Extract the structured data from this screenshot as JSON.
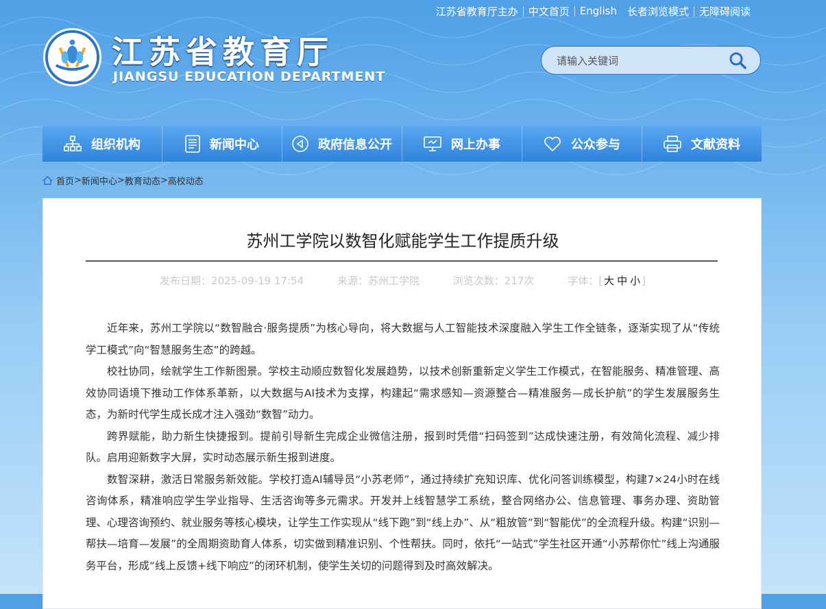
{
  "top_links": [
    "江苏省教育厅主办",
    "中文首页",
    "English",
    "长者浏览模式",
    "无障碍阅读"
  ],
  "site": {
    "title": "江苏省教育厅",
    "subtitle": "JIANGSU EDUCATION DEPARTMENT"
  },
  "search": {
    "placeholder": "请输入关键词"
  },
  "nav": [
    {
      "label": "组织机构",
      "icon": "org-chart-icon"
    },
    {
      "label": "新闻中心",
      "icon": "document-icon"
    },
    {
      "label": "政府信息公开",
      "icon": "megaphone-icon"
    },
    {
      "label": "网上办事",
      "icon": "monitor-icon"
    },
    {
      "label": "公众参与",
      "icon": "heart-icon"
    },
    {
      "label": "文献资料",
      "icon": "printer-icon"
    }
  ],
  "breadcrumb": [
    "首页",
    "新闻中心",
    "教育动态",
    "高校动态"
  ],
  "article": {
    "title": "苏州工学院以数智化赋能学生工作提质升级",
    "publish_date": "发布日期：2025-09-19 17:54",
    "source": "来源：苏州工学院",
    "views": "浏览次数：217次",
    "font_label": "字体：[",
    "font_large": "大",
    "font_medium": "中",
    "font_small": "小",
    "font_close": "]",
    "paragraphs": [
      "近年来，苏州工学院以“数智融合·服务提质”为核心导向，将大数据与人工智能技术深度融入学生工作全链条，逐渐实现了从“传统学工模式”向“智慧服务生态”的跨越。",
      "校社协同，绘就学生工作新图景。学校主动顺应数智化发展趋势，以技术创新重新定义学生工作模式，在智能服务、精准管理、高效协同语境下推动工作体系革新，以大数据与AI技术为支撑，构建起“需求感知—资源整合—精准服务—成长护航”的学生发展服务生态，为新时代学生成长成才注入强劲“数智”动力。",
      "跨界赋能，助力新生快捷报到。提前引导新生完成企业微信注册，报到时凭借“扫码签到”达成快速注册，有效简化流程、减少排队。启用迎新数字大屏，实时动态展示新生报到进度。",
      "数智深耕，激活日常服务新效能。学校打造AI辅导员“小苏老师”，通过持续扩充知识库、优化问答训练模型，构建7×24小时在线咨询体系，精准响应学生学业指导、生活咨询等多元需求。开发并上线智慧学工系统，整合网络办公、信息管理、事务办理、资助管理、心理咨询预约、就业服务等核心模块，让学生工作实现从“线下跑”到“线上办”、从“粗放管”到“智能优”的全流程升级。构建“识别—帮扶—培育—发展”的全周期资助育人体系，切实做到精准识别、个性帮扶。同时，依托“一站式”学生社区开通“小苏帮你忙”线上沟通服务平台，形成“线上反馈+线下响应”的闭环机制，使学生关切的问题得到及时高效解决。"
    ]
  }
}
